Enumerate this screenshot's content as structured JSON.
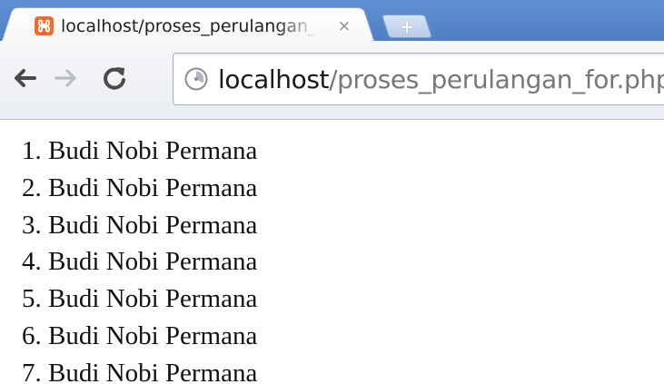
{
  "tab": {
    "title": "localhost/proses_perulangan_for.php",
    "close_glyph": "×",
    "favicon": "xampp-icon",
    "favicon_color": "#f36c2e"
  },
  "new_tab": {
    "icon": "plus-icon",
    "glyph": "+"
  },
  "toolbar": {
    "back_icon": "back-arrow-icon",
    "forward_icon": "forward-arrow-icon",
    "reload_icon": "reload-icon"
  },
  "address_bar": {
    "icon": "page-info-icon",
    "host": "localhost",
    "path": "/proses_perulangan_for.php"
  },
  "colors": {
    "tabstrip": "#5f8fd0",
    "toolbar": "#eef1f4",
    "url_host": "#1a1a1a",
    "url_path": "#777777"
  },
  "page": {
    "items": [
      "1. Budi Nobi Permana",
      "2. Budi Nobi Permana",
      "3. Budi Nobi Permana",
      "4. Budi Nobi Permana",
      "5. Budi Nobi Permana",
      "6. Budi Nobi Permana",
      "7. Budi Nobi Permana"
    ]
  }
}
